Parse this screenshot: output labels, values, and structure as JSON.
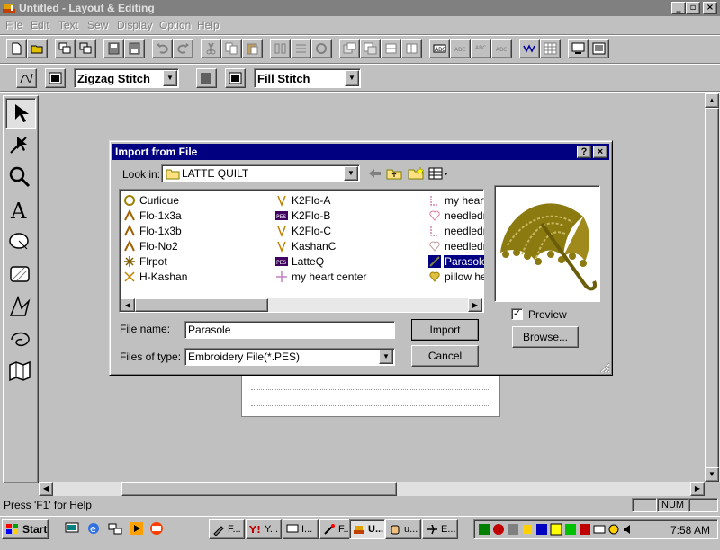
{
  "window": {
    "title": "Untitled - Layout & Editing",
    "controls": {
      "minimize": "_",
      "maximize": "▫",
      "close": "×"
    }
  },
  "menu": [
    "File",
    "Edit",
    "Text",
    "Sew",
    "Display",
    "Option",
    "Help"
  ],
  "toolbar2": {
    "stitch_combo": "Zigzag Stitch",
    "fill_combo": "Fill Stitch"
  },
  "dialog": {
    "title": "Import from File",
    "help_btn": "?",
    "close_btn": "×",
    "look_in_label": "Look in:",
    "look_in_value": "LATTE QUILT",
    "files": [
      [
        {
          "name": "Curlicue",
          "icon": "stitch-file-icon"
        },
        {
          "name": "Flo-1x3a",
          "icon": "stitch-file-icon"
        },
        {
          "name": "Flo-1x3b",
          "icon": "stitch-file-icon"
        },
        {
          "name": "Flo-No2",
          "icon": "stitch-file-icon"
        },
        {
          "name": "Flrpot",
          "icon": "stitch-file-icon"
        },
        {
          "name": "H-Kashan",
          "icon": "stitch-file-icon"
        }
      ],
      [
        {
          "name": "K2Flo-A",
          "icon": "stitch-file-icon"
        },
        {
          "name": "K2Flo-B",
          "icon": "pes-file-icon"
        },
        {
          "name": "K2Flo-C",
          "icon": "stitch-file-icon"
        },
        {
          "name": "KashanC",
          "icon": "stitch-file-icon"
        },
        {
          "name": "LatteQ",
          "icon": "pes-file-icon"
        },
        {
          "name": "my heart center",
          "icon": "stitch-file-icon"
        }
      ],
      [
        {
          "name": "my heart",
          "icon": "stitch-file-icon"
        },
        {
          "name": "needledre",
          "icon": "heart-file-icon"
        },
        {
          "name": "needledre",
          "icon": "stitch-file-icon"
        },
        {
          "name": "needledre",
          "icon": "heart-file-icon"
        },
        {
          "name": "Parasole",
          "icon": "stitch-file-icon",
          "selected": true
        },
        {
          "name": "pillow hea",
          "icon": "heart-file-icon"
        }
      ]
    ],
    "file_name_label": "File name:",
    "file_name_value": "Parasole",
    "files_of_type_label": "Files of type:",
    "files_of_type_value": "Embroidery File(*.PES)",
    "import_button": "Import",
    "cancel_button": "Cancel",
    "preview_label": "Preview",
    "preview_checked": true,
    "browse_button": "Browse..."
  },
  "status": {
    "text": "Press 'F1' for Help",
    "num": "NUM"
  },
  "taskbar": {
    "start": "Start",
    "tasks": [
      "F...",
      "Y...",
      "I...",
      "F...",
      "U...",
      "u...",
      "E..."
    ],
    "clock": "7:58 AM"
  },
  "colors": {
    "titlebar_inactive": "#808080",
    "dialog_title": "#000080",
    "parasol": "#8b7a10"
  }
}
